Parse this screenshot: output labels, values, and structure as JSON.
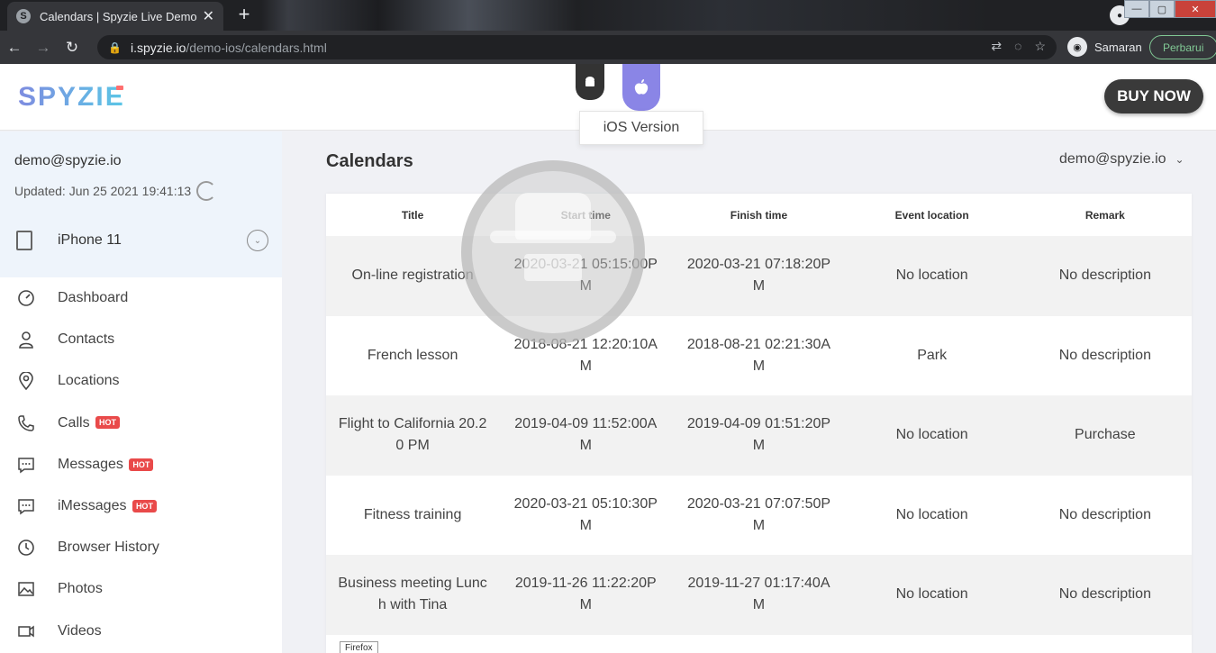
{
  "browser": {
    "tab_title": "Calendars | Spyzie Live Demo",
    "tab_favicon": "S",
    "url_host": "i.spyzie.io",
    "url_path": "/demo-ios/calendars.html",
    "profile_name": "Samaran",
    "update_label": "Perbarui"
  },
  "header": {
    "logo": "SPYZIE",
    "os_tooltip": "iOS Version",
    "buy_label": "BUY NOW"
  },
  "account": {
    "email": "demo@spyzie.io",
    "updated": "Updated: Jun 25 2021 19:41:13",
    "device": "iPhone 11"
  },
  "menu": [
    {
      "label": "Dashboard",
      "icon": "dashboard-icon"
    },
    {
      "label": "Contacts",
      "icon": "contacts-icon"
    },
    {
      "label": "Locations",
      "icon": "location-pin-icon"
    },
    {
      "label": "Calls",
      "icon": "phone-icon",
      "badge": "HOT"
    },
    {
      "label": "Messages",
      "icon": "message-icon",
      "badge": "HOT"
    },
    {
      "label": "iMessages",
      "icon": "imessage-icon",
      "badge": "HOT"
    },
    {
      "label": "Browser History",
      "icon": "clock-icon"
    },
    {
      "label": "Photos",
      "icon": "photo-icon"
    },
    {
      "label": "Videos",
      "icon": "video-icon"
    }
  ],
  "main": {
    "title": "Calendars",
    "user_menu": "demo@spyzie.io"
  },
  "table": {
    "headers": [
      "Title",
      "Start time",
      "Finish time",
      "Event location",
      "Remark"
    ],
    "rows": [
      [
        "On-line registration",
        "2020-03-21 05:15:00PM",
        "2020-03-21 07:18:20PM",
        "No location",
        "No description"
      ],
      [
        "French lesson",
        "2018-08-21 12:20:10AM",
        "2018-08-21 02:21:30AM",
        "Park",
        "No description"
      ],
      [
        "Flight to California 20.20 PM",
        "2019-04-09 11:52:00AM",
        "2019-04-09 01:51:20PM",
        "No location",
        "Purchase"
      ],
      [
        "Fitness training",
        "2020-03-21 05:10:30PM",
        "2020-03-21 07:07:50PM",
        "No location",
        "No description"
      ],
      [
        "Business meeting Lunch with Tina",
        "2019-11-26 11:22:20PM",
        "2019-11-27 01:17:40AM",
        "No location",
        "No description"
      ]
    ]
  },
  "tooltip_firefox": "Firefox",
  "colors": {
    "accent_ios": "#8a85e6",
    "hot_badge": "#e94a4a",
    "sidebar_account_bg": "#eef4fb"
  }
}
